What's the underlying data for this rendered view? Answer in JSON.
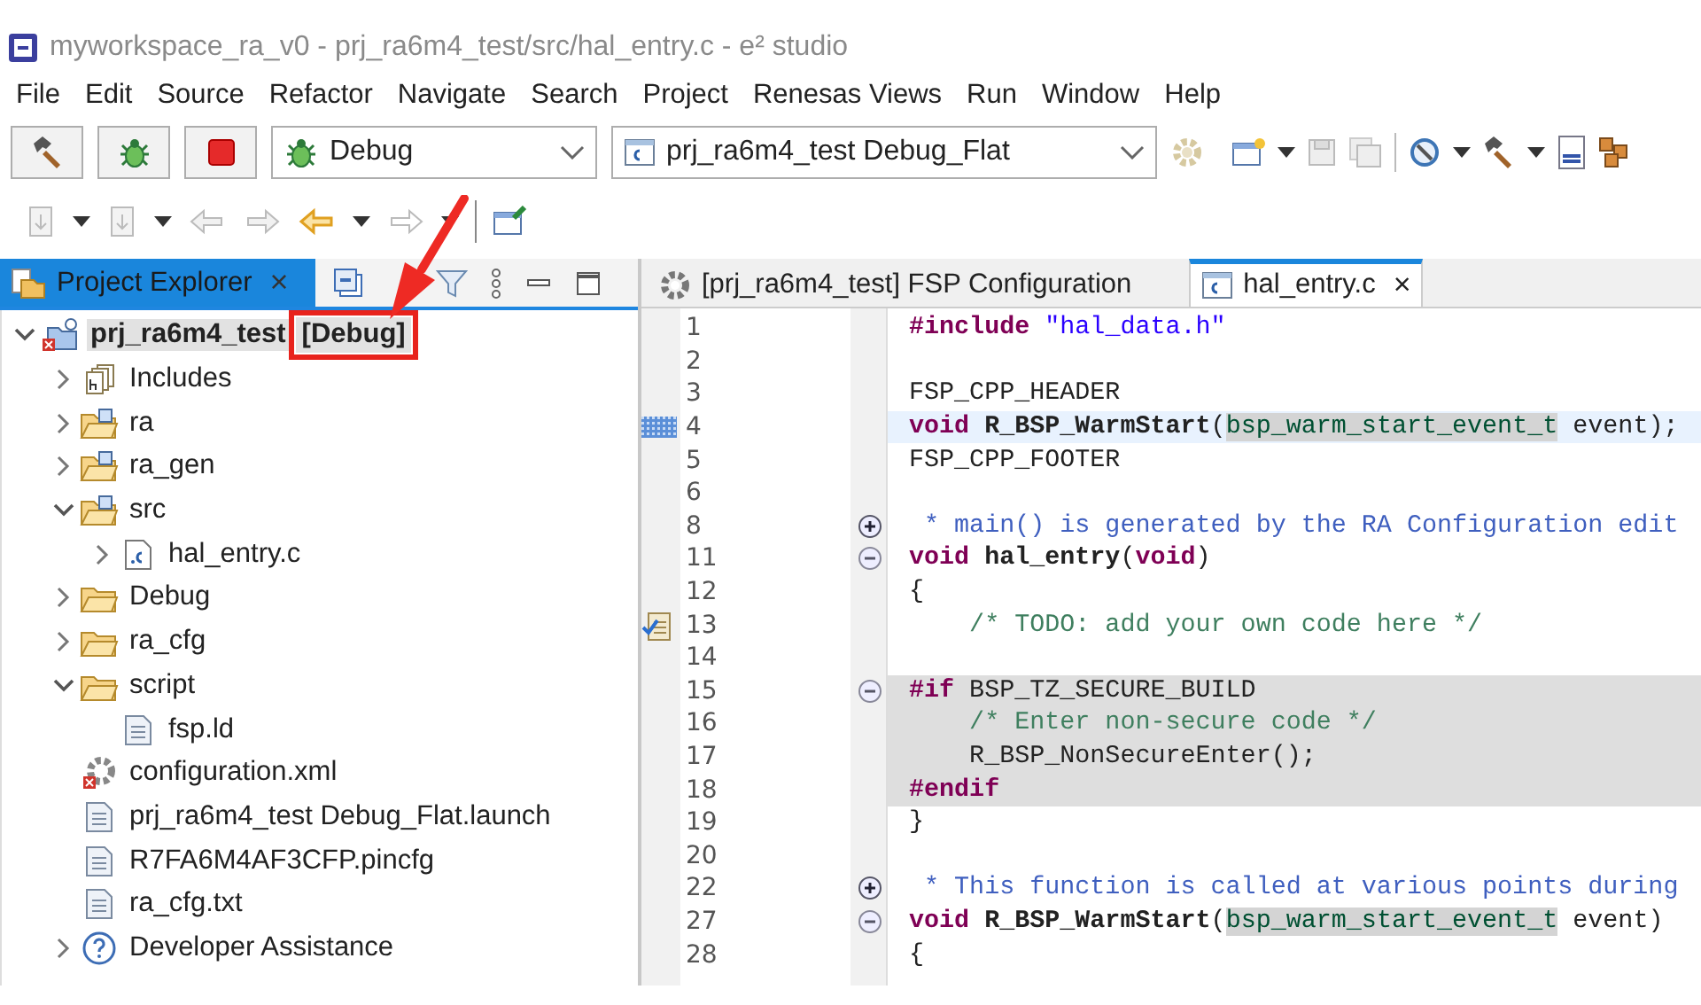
{
  "window": {
    "title": "myworkspace_ra_v0 - prj_ra6m4_test/src/hal_entry.c - e² studio"
  },
  "menu": [
    "File",
    "Edit",
    "Source",
    "Refactor",
    "Navigate",
    "Search",
    "Project",
    "Renesas Views",
    "Run",
    "Window",
    "Help"
  ],
  "toolbar": {
    "launch_mode": "Debug",
    "launch_config": "prj_ra6m4_test Debug_Flat"
  },
  "project_explorer": {
    "title": "Project Explorer",
    "close": "×",
    "tree": [
      {
        "label": "prj_ra6m4_test",
        "config": "[Debug]",
        "config_highlighted": true,
        "kind": "project",
        "expanded": true,
        "selected": true,
        "children": [
          {
            "label": "Includes",
            "kind": "includes",
            "expanded": false,
            "selected": false
          },
          {
            "label": "ra",
            "kind": "source-folder",
            "expanded": false,
            "selected": false
          },
          {
            "label": "ra_gen",
            "kind": "source-folder",
            "expanded": false,
            "selected": false
          },
          {
            "label": "src",
            "kind": "source-folder",
            "expanded": true,
            "selected": false,
            "children": [
              {
                "label": "hal_entry.c",
                "kind": "c-file",
                "expanded": false,
                "selected": false
              }
            ]
          },
          {
            "label": "Debug",
            "kind": "folder",
            "expanded": false,
            "selected": false
          },
          {
            "label": "ra_cfg",
            "kind": "folder",
            "expanded": false,
            "selected": false
          },
          {
            "label": "script",
            "kind": "folder",
            "expanded": true,
            "selected": false,
            "children": [
              {
                "label": "fsp.ld",
                "kind": "file",
                "selected": false
              }
            ]
          },
          {
            "label": "configuration.xml",
            "kind": "config-file",
            "selected": false
          },
          {
            "label": "prj_ra6m4_test Debug_Flat.launch",
            "kind": "file",
            "selected": false
          },
          {
            "label": "R7FA6M4AF3CFP.pincfg",
            "kind": "file",
            "selected": false
          },
          {
            "label": "ra_cfg.txt",
            "kind": "file",
            "selected": false
          },
          {
            "label": "Developer Assistance",
            "kind": "help",
            "expanded": false,
            "selected": false
          }
        ]
      }
    ]
  },
  "annotation": {
    "arrow": true
  },
  "editor": {
    "tabs": [
      {
        "label": "[prj_ra6m4_test] FSP Configuration",
        "kind": "config",
        "selected": false
      },
      {
        "label": "hal_entry.c",
        "kind": "c-file",
        "selected": true,
        "close": "×"
      }
    ],
    "lines": [
      {
        "number": "1",
        "tokens": [
          {
            "kind": "keyword",
            "text": "#include"
          },
          {
            "kind": "string",
            "text": " \"hal_data.h\""
          }
        ]
      },
      {
        "number": "2"
      },
      {
        "number": "3",
        "tokens": [
          {
            "kind": "plain",
            "text": "FSP_CPP_HEADER"
          }
        ]
      },
      {
        "number": "4",
        "current": true,
        "occurrence_marker": true,
        "tokens": [
          {
            "kind": "keyword",
            "text": "void"
          },
          {
            "kind": "bold",
            "text": " R_BSP_WarmStart"
          },
          {
            "kind": "plain",
            "text": "("
          },
          {
            "kind": "mark",
            "text": "bsp_warm_start_event_t"
          },
          {
            "kind": "plain",
            "text": " event);"
          }
        ]
      },
      {
        "number": "5",
        "tokens": [
          {
            "kind": "plain",
            "text": "FSP_CPP_FOOTER"
          }
        ]
      },
      {
        "number": "6"
      },
      {
        "number": "8",
        "folded": true,
        "tokens": [
          {
            "kind": "doc",
            "text": " * main() is generated by the RA Configuration edit"
          }
        ]
      },
      {
        "number": "11",
        "folded": false,
        "tokens": [
          {
            "kind": "keyword",
            "text": "void"
          },
          {
            "kind": "bold",
            "text": " hal_entry"
          },
          {
            "kind": "plain",
            "text": "("
          },
          {
            "kind": "keyword",
            "text": "void"
          },
          {
            "kind": "plain",
            "text": ")"
          }
        ]
      },
      {
        "number": "12",
        "tokens": [
          {
            "kind": "plain",
            "text": "{"
          }
        ]
      },
      {
        "number": "13",
        "task_marker": true,
        "tokens": [
          {
            "kind": "comment",
            "text": "    /* TODO: add your own code here */"
          }
        ]
      },
      {
        "number": "14"
      },
      {
        "number": "15",
        "folded": false,
        "inactive": true,
        "tokens": [
          {
            "kind": "keyword",
            "text": "#if"
          },
          {
            "kind": "plain",
            "text": " BSP_TZ_SECURE_BUILD"
          }
        ]
      },
      {
        "number": "16",
        "inactive": true,
        "tokens": [
          {
            "kind": "comment",
            "text": "    /* Enter non-secure code */"
          }
        ]
      },
      {
        "number": "17",
        "inactive": true,
        "tokens": [
          {
            "kind": "plain",
            "text": "    R_BSP_NonSecureEnter();"
          }
        ]
      },
      {
        "number": "18",
        "inactive": true,
        "tokens": [
          {
            "kind": "keyword",
            "text": "#endif"
          }
        ]
      },
      {
        "number": "19",
        "tokens": [
          {
            "kind": "plain",
            "text": "}"
          }
        ]
      },
      {
        "number": "20"
      },
      {
        "number": "22",
        "folded": true,
        "tokens": [
          {
            "kind": "doc",
            "text": " * This function is called at various points during"
          }
        ]
      },
      {
        "number": "27",
        "folded": false,
        "tokens": [
          {
            "kind": "keyword",
            "text": "void"
          },
          {
            "kind": "bold",
            "text": " R_BSP_WarmStart"
          },
          {
            "kind": "plain",
            "text": "("
          },
          {
            "kind": "mark",
            "text": "bsp_warm_start_event_t"
          },
          {
            "kind": "plain",
            "text": " event)"
          }
        ]
      },
      {
        "number": "28",
        "tokens": [
          {
            "kind": "plain",
            "text": "{"
          }
        ]
      }
    ]
  }
}
